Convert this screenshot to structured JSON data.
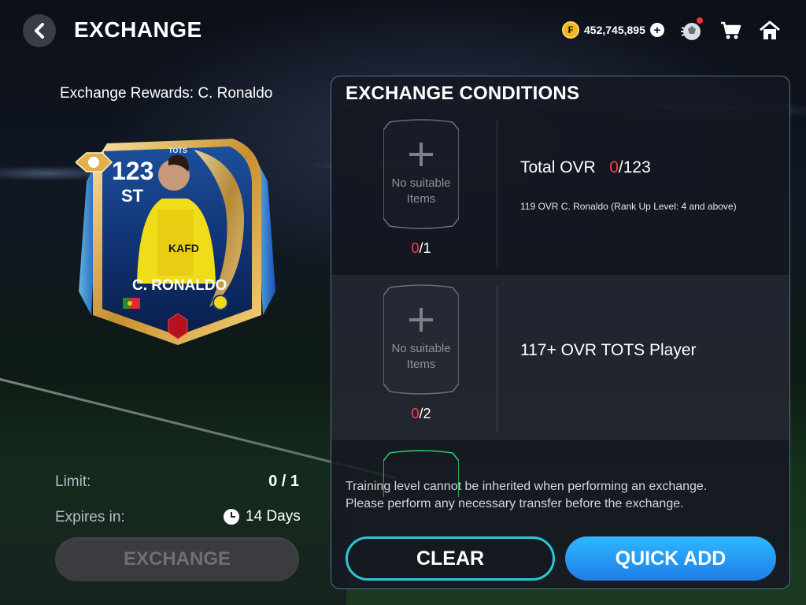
{
  "header": {
    "title": "EXCHANGE",
    "coins": "452,745,895",
    "icons": [
      "back-chevron-icon",
      "coin-icon",
      "plus-icon",
      "ball-notification-icon",
      "cart-icon",
      "home-icon"
    ]
  },
  "reward": {
    "title": "Exchange Rewards:  C. Ronaldo",
    "card": {
      "rating": "123",
      "position": "ST",
      "program": "TOTS",
      "name": "C. RONALDO"
    },
    "limit_label": "Limit:",
    "limit_value": "0 / 1",
    "expires_label": "Expires in:",
    "expires_value": "14 Days",
    "exchange_button": "EXCHANGE"
  },
  "conditions": {
    "title": "EXCHANGE CONDITIONS",
    "rows": [
      {
        "slot_text_1": "No suitable",
        "slot_text_2": "Items",
        "count_have": "0",
        "count_need": "/1",
        "label": "Total OVR",
        "progress_have": "0",
        "progress_need": "/123",
        "sub": "119 OVR C. Ronaldo (Rank Up Level: 4 and above)"
      },
      {
        "slot_text_1": "No suitable",
        "slot_text_2": "Items",
        "count_have": "0",
        "count_need": "/2",
        "label": "117+ OVR TOTS Player"
      }
    ],
    "notice_line1": "Training level cannot be inherited when performing an exchange.",
    "notice_line2": "Please perform any necessary transfer before the exchange.",
    "clear_button": "CLEAR",
    "quick_add_button": "QUICK ADD"
  },
  "colors": {
    "accent_red": "#ff3d4d",
    "clear_border": "#27c9d9",
    "quick_add_blue": "#2fb8ff",
    "card_gold": "#e0b14a"
  }
}
